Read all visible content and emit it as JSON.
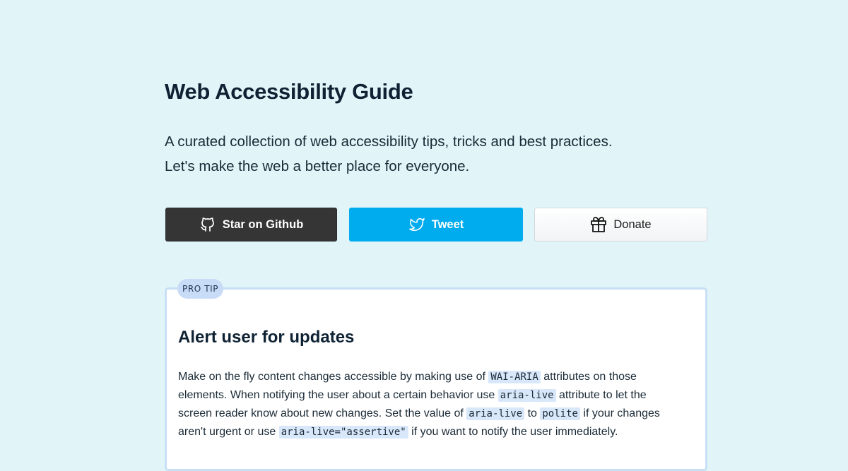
{
  "page": {
    "title": "Web Accessibility Guide",
    "intro_line_1": "A curated collection of web accessibility tips, tricks and best practices.",
    "intro_line_2": "Let's make the web a better place for everyone."
  },
  "buttons": {
    "github": {
      "label": "Star on Github",
      "icon": "github-icon",
      "color": "#353535"
    },
    "tweet": {
      "label": "Tweet",
      "icon": "twitter-icon",
      "color": "#00acee"
    },
    "donate": {
      "label": "Donate",
      "icon": "gift-icon",
      "color": "#ffffff"
    }
  },
  "tip": {
    "badge": "PRO TIP",
    "title": "Alert user for updates",
    "body": {
      "t1": "Make on the fly content changes accessible by making use of ",
      "c1": "WAI-ARIA",
      "t2": " attributes on those",
      "t3": "elements. When notifying the user about a certain behavior use ",
      "c2": "aria-live",
      "t4": " attribute to let the",
      "t5": "screen reader know about new changes. Set the value of ",
      "c3": "aria-live",
      "t6": " to ",
      "c4": "polite",
      "t7": " if your changes",
      "t8": "aren't urgent or use ",
      "c5": "aria-live=\"assertive\"",
      "t9": " if you want to notify the user immediately."
    }
  },
  "colors": {
    "background": "#e1f5f9",
    "code_highlight": "#d8e8fa",
    "badge": "#c8dcf7",
    "card_border": "#c7dff4"
  }
}
